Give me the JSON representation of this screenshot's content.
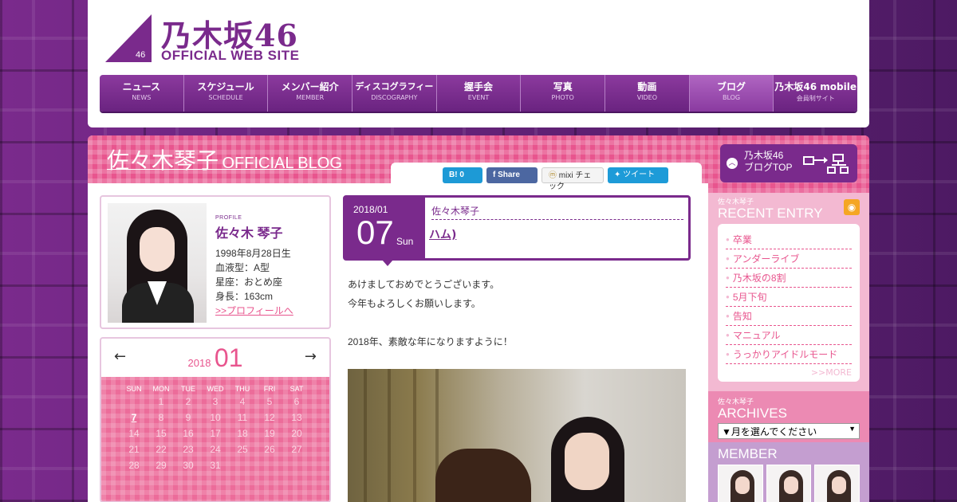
{
  "logo": {
    "jp": "乃木坂46",
    "en": "OFFICIAL WEB SITE",
    "badge": "46"
  },
  "nav": [
    {
      "jp": "ニュース",
      "en": "NEWS"
    },
    {
      "jp": "スケジュール",
      "en": "SCHEDULE"
    },
    {
      "jp": "メンバー紹介",
      "en": "MEMBER"
    },
    {
      "jp": "ディスコグラフィー",
      "en": "DISCOGRAPHY"
    },
    {
      "jp": "握手会",
      "en": "EVENT"
    },
    {
      "jp": "写真",
      "en": "PHOTO"
    },
    {
      "jp": "動画",
      "en": "VIDEO"
    },
    {
      "jp": "ブログ",
      "en": "BLOG"
    },
    {
      "jp": "乃木坂46 mobile",
      "en": "会員制サイト"
    }
  ],
  "blog": {
    "title_jp": "佐々木琴子",
    "title_en": "OFFICIAL BLOG"
  },
  "social": {
    "hatena": "B! 0",
    "facebook": "Share",
    "mixi": "mixi チェック",
    "twitter": "ツイート"
  },
  "profile": {
    "label": "PROFILE",
    "name": "佐々木 琴子",
    "birth": "1998年8月28日生",
    "blood": "血液型：A型",
    "sign": "星座：おとめ座",
    "height": "身長：163cm",
    "link": ">>プロフィールへ"
  },
  "calendar": {
    "year": "2018",
    "month": "01",
    "prev": "←",
    "next": "→",
    "dow": [
      "SUN",
      "MON",
      "TUE",
      "WED",
      "THU",
      "FRI",
      "SAT"
    ],
    "days": [
      "",
      "1",
      "2",
      "3",
      "4",
      "5",
      "6",
      "7",
      "8",
      "9",
      "10",
      "11",
      "12",
      "13",
      "14",
      "15",
      "16",
      "17",
      "18",
      "19",
      "20",
      "21",
      "22",
      "23",
      "24",
      "25",
      "26",
      "27",
      "28",
      "29",
      "30",
      "31"
    ],
    "linked_day": "7"
  },
  "post": {
    "ym": "2018/01",
    "day": "07",
    "weekday": "Sun",
    "author": "佐々木琴子",
    "title": "ハム)",
    "lines": [
      "あけましておめでとうございます。",
      "今年もよろしくお願いします。",
      "",
      "2018年、素敵な年になりますように！"
    ]
  },
  "sidebar": {
    "blog_top": {
      "line1": "乃木坂46",
      "line2": "ブログTOP",
      "icon": "sitemap-icon"
    },
    "recent": {
      "small": "佐々木琴子",
      "title": "RECENT ENTRY",
      "items": [
        "卒業",
        "アンダーライブ",
        "乃木坂の8割",
        "5月下旬",
        "告知",
        "マニュアル",
        "うっかりアイドルモード"
      ],
      "more": ">>MORE"
    },
    "archives": {
      "small": "佐々木琴子",
      "title": "ARCHIVES",
      "select": "▼月を選んでください",
      "arrow": "▼"
    },
    "member": {
      "title": "MEMBER"
    }
  },
  "colors": {
    "purple": "#7a2a8c",
    "pink": "#e8558e",
    "light_pink": "#f3b9d2"
  }
}
